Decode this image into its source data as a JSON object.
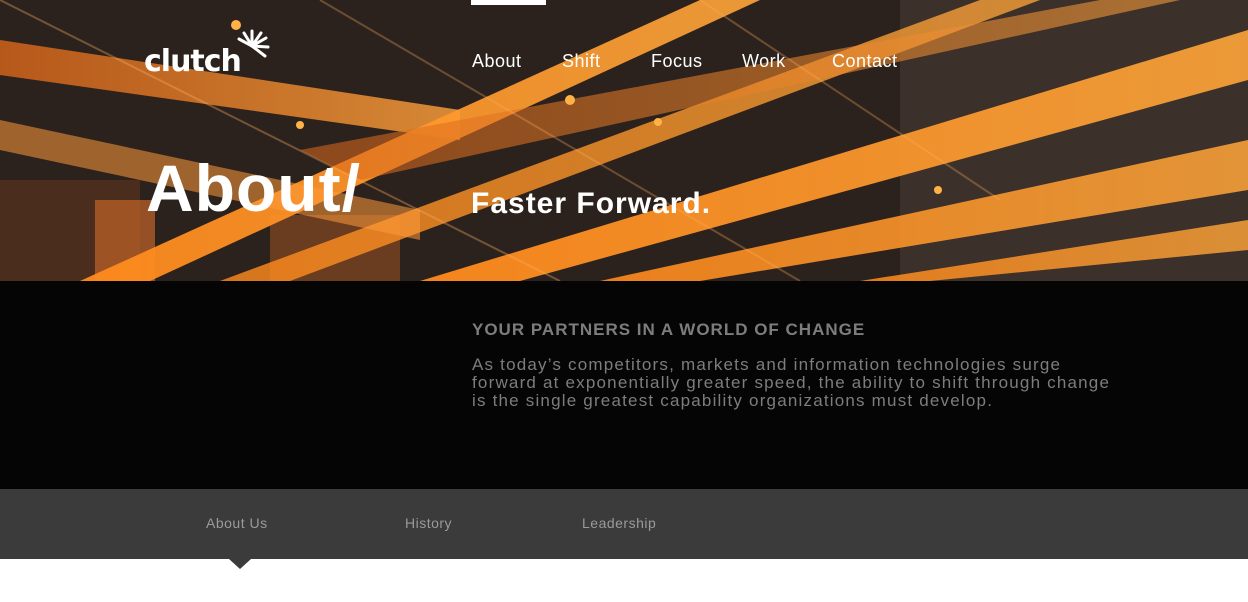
{
  "brand": {
    "logo_text": "clutch"
  },
  "nav": {
    "items": [
      {
        "label": "About",
        "active": true
      },
      {
        "label": "Shift"
      },
      {
        "label": "Focus"
      },
      {
        "label": "Work"
      },
      {
        "label": "Contact"
      }
    ]
  },
  "hero": {
    "heading": "About/",
    "tagline": "Faster Forward."
  },
  "intro": {
    "heading": "YOUR PARTNERS IN A WORLD OF CHANGE",
    "body": "As today’s competitors, markets and information technologies surge forward at exponentially greater speed, the ability to shift through change is the single greatest capability organizations must develop."
  },
  "subnav": {
    "items": [
      {
        "label": "About Us",
        "active": true
      },
      {
        "label": "History"
      },
      {
        "label": "Leadership"
      }
    ]
  },
  "colors": {
    "accent": "#f7931e",
    "hero_dark": "#2a1f1a",
    "intro_bg": "#050505",
    "subnav_bg": "#3b3b3b",
    "muted_text": "#7d7d7d"
  },
  "icons": {
    "logo_mark": "sunburst-icon"
  }
}
